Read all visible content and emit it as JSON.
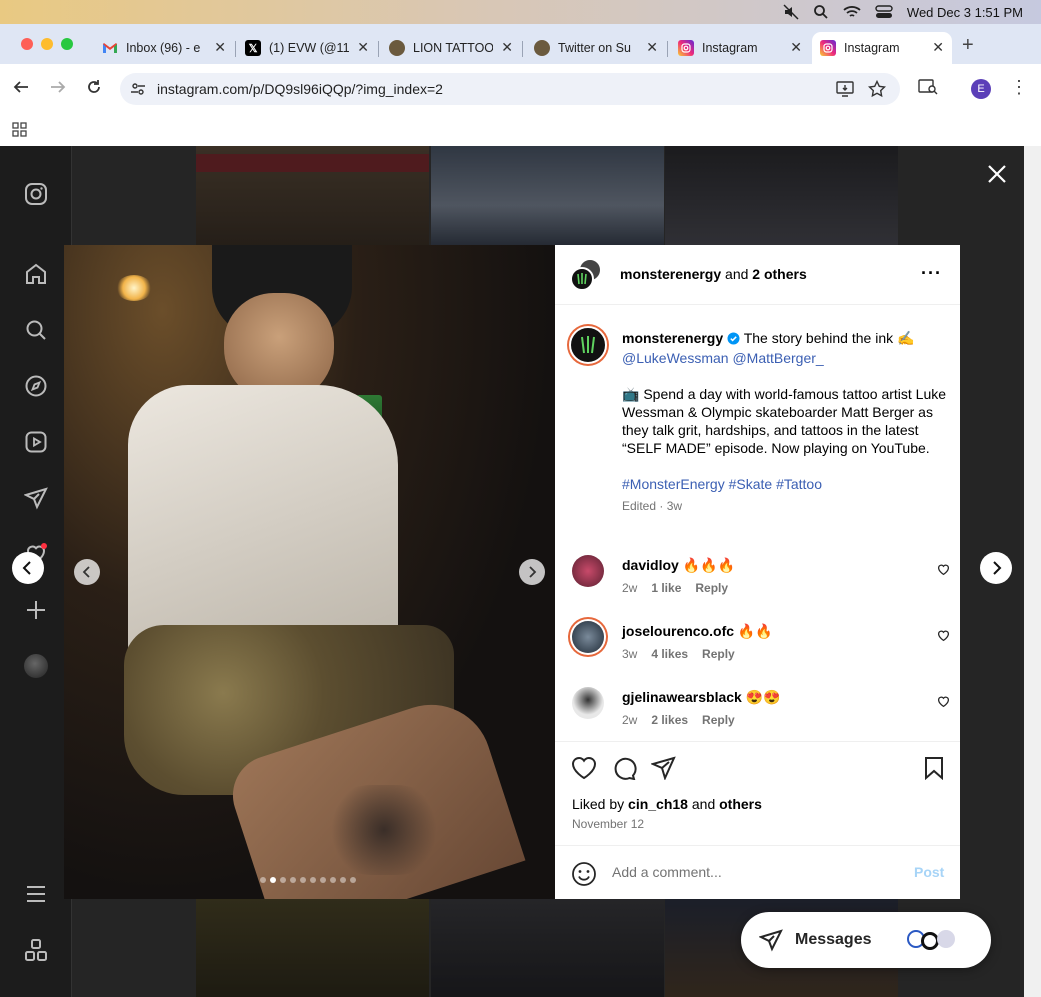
{
  "menubar": {
    "datetime": "Wed Dec 3  1:51 PM",
    "icons": [
      "mute-icon",
      "search-icon",
      "wifi-icon",
      "control-center-icon"
    ]
  },
  "browser": {
    "tabs": [
      {
        "title": "Inbox (96) - e",
        "favicon": "gmail-icon"
      },
      {
        "title": "(1) EVW (@11",
        "favicon": "x-icon"
      },
      {
        "title": "LION TATTOO",
        "favicon": "lion-icon"
      },
      {
        "title": "Twitter on Su",
        "favicon": "lion-icon"
      },
      {
        "title": "Instagram",
        "favicon": "instagram-icon"
      },
      {
        "title": "Instagram",
        "favicon": "instagram-icon",
        "active": true
      }
    ],
    "url": "instagram.com/p/DQ9sl96iQQp/?img_index=2",
    "profile_initial": "E"
  },
  "post": {
    "header_user": "monsterenergy",
    "header_and": "and",
    "header_others": "2 others",
    "caption_user": "monsterenergy",
    "caption_line1": "The story behind the ink ✍️",
    "mentions": "@LukeWessman @MattBerger_",
    "caption_body": "📺 Spend a day with world-famous tattoo artist Luke Wessman & Olympic skateboarder Matt Berger as they talk grit, hardships, and tattoos in the latest “SELF MADE” episode. Now playing on YouTube.",
    "hashtags": "#MonsterEnergy #Skate #Tattoo",
    "edited": "Edited · 3w",
    "comments": [
      {
        "user": "davidloy",
        "text": "🔥🔥🔥",
        "age": "2w",
        "likes": "1 like",
        "reply": "Reply"
      },
      {
        "user": "joselourenco.ofc",
        "text": "🔥🔥",
        "age": "3w",
        "likes": "4 likes",
        "reply": "Reply"
      },
      {
        "user": "gjelinawearsblack",
        "text": "😍😍",
        "age": "2w",
        "likes": "2 likes",
        "reply": "Reply"
      }
    ],
    "liked_by_prefix": "Liked by",
    "liked_by_user": "cin_ch18",
    "liked_by_and": "and",
    "liked_by_others": "others",
    "date": "November 12",
    "comment_placeholder": "Add a comment...",
    "post_button": "Post",
    "image_index": 2,
    "image_count": 10
  },
  "messages": {
    "label": "Messages"
  },
  "colors": {
    "accent_blue": "#0095f6",
    "mention_blue": "#3b5fb3",
    "profile": "#5b3fb8"
  }
}
